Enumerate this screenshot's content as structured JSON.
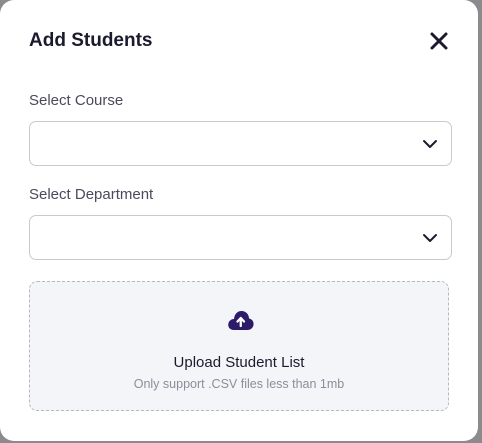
{
  "modal": {
    "title": "Add Students",
    "close_icon": "close-icon"
  },
  "course_field": {
    "label": "Select Course",
    "value": "",
    "icon": "chevron-down-icon"
  },
  "department_field": {
    "label": "Select Department",
    "value": "",
    "icon": "chevron-down-icon"
  },
  "upload": {
    "icon": "cloud-upload-icon",
    "title": "Upload Student List",
    "hint": "Only support .CSV files less than 1mb"
  },
  "colors": {
    "accent": "#2d1b69",
    "text": "#1c1b2e",
    "muted": "#8d8c9b",
    "dropzone_bg": "#f4f5f9"
  }
}
